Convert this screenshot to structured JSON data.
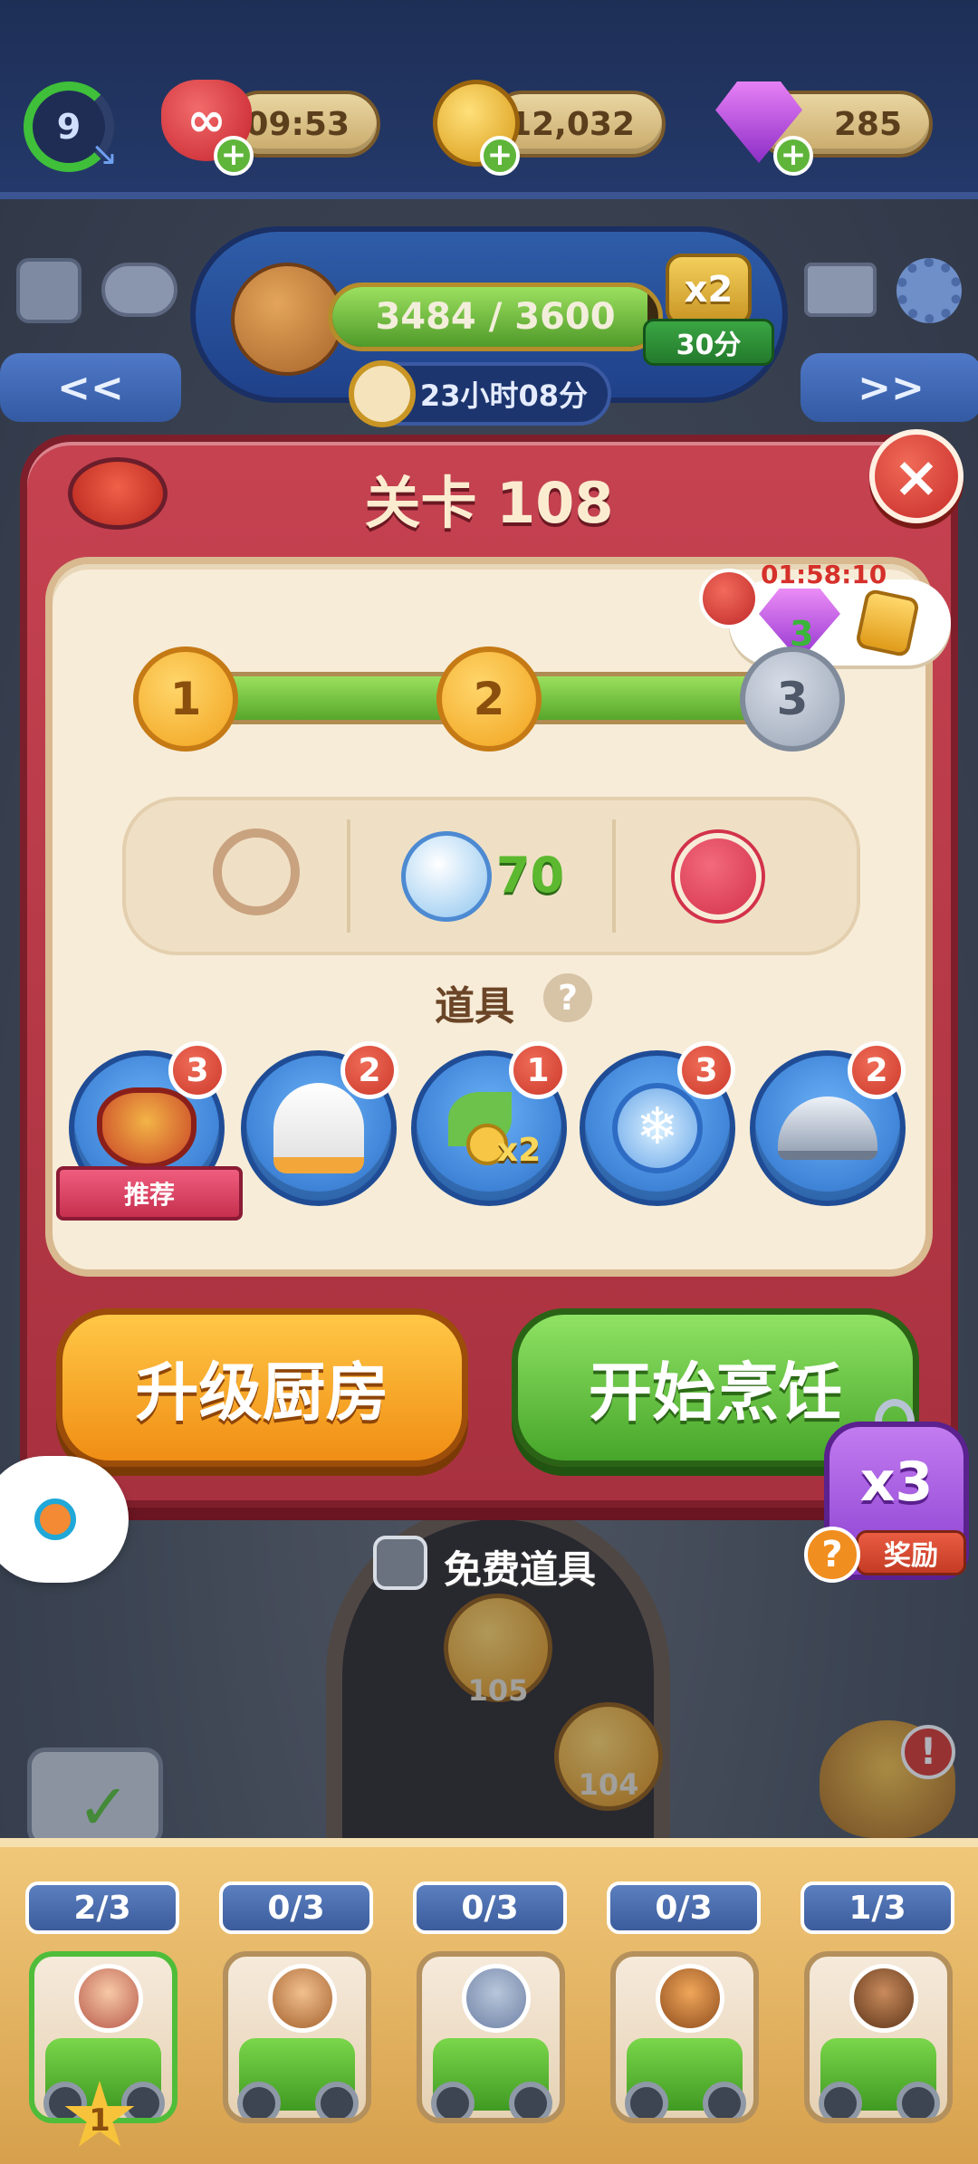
{
  "hud": {
    "level": "9",
    "lives_timer": "09:53",
    "coins": "12,032",
    "gems": "285"
  },
  "event": {
    "progress_text": "3484 / 3600",
    "progress_value": 3484,
    "progress_max": 3600,
    "multiplier": "x2",
    "multiplier_time": "30分",
    "time_left": "23小时08分",
    "nav_prev": "<<",
    "nav_next": ">>"
  },
  "modal": {
    "title": "关卡 108",
    "close": "×",
    "stars": [
      "1",
      "2",
      "3"
    ],
    "stars_earned": 2,
    "bonus_timer": "01:58:10",
    "bonus_gems": "3",
    "goal_customers": "70",
    "boosters_label": "道具",
    "help": "?",
    "boosters": [
      {
        "name": "pot",
        "count": "3",
        "tag": "推荐"
      },
      {
        "name": "chef-hat",
        "count": "2"
      },
      {
        "name": "coins-x2",
        "count": "1",
        "overlay": "x2"
      },
      {
        "name": "freeze-clock",
        "count": "3"
      },
      {
        "name": "serving-cloche",
        "count": "2"
      }
    ],
    "upgrade_button": "升级厨房",
    "start_button": "开始烹饪"
  },
  "free_items": {
    "label": "免费道具"
  },
  "reward_tag": {
    "multiplier": "x3",
    "label": "奖励",
    "help": "?"
  },
  "map_levels": [
    "105",
    "104"
  ],
  "bottom_slots": [
    {
      "label": "2/3",
      "badge": "1"
    },
    {
      "label": "0/3"
    },
    {
      "label": "0/3"
    },
    {
      "label": "0/3"
    },
    {
      "label": "1/3"
    }
  ],
  "colors": {
    "modal_red": "#b53644",
    "upgrade_orange": "#f5a623",
    "start_green": "#5bbd33",
    "reward_purple": "#9b4fde"
  }
}
